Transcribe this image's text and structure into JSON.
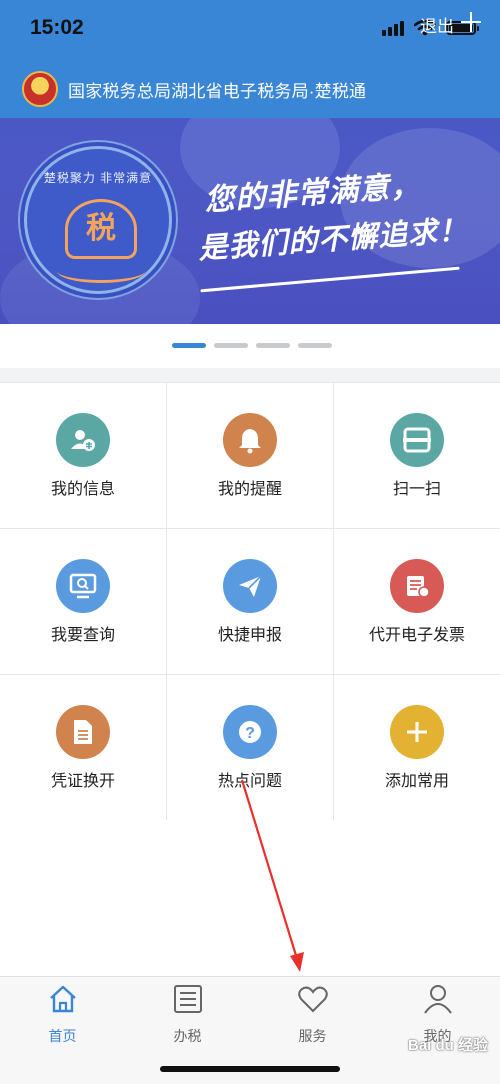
{
  "status_bar": {
    "time": "15:02"
  },
  "header": {
    "title": "国家税务总局湖北省电子税务局·楚税通",
    "logout_label": "退出",
    "accent_color": "#3a86d6"
  },
  "banner": {
    "seal_text": "楚税聚力 非常满意",
    "seal_char": "税",
    "slogan_line1": "您的非常满意，",
    "slogan_line2": "是我们的不懈追求！",
    "slides_total": 4,
    "active_slide": 1
  },
  "grid": {
    "items": [
      {
        "label": "我的信息",
        "icon": "user-info-icon",
        "color": "#5aa7a3"
      },
      {
        "label": "我的提醒",
        "icon": "bell-icon",
        "color": "#d1834e"
      },
      {
        "label": "扫一扫",
        "icon": "scan-icon",
        "color": "#5aa7a3"
      },
      {
        "label": "我要查询",
        "icon": "query-icon",
        "color": "#5a9be0"
      },
      {
        "label": "快捷申报",
        "icon": "send-icon",
        "color": "#5a9be0"
      },
      {
        "label": "代开电子发票",
        "icon": "invoice-icon",
        "color": "#d75a56"
      },
      {
        "label": "凭证换开",
        "icon": "document-icon",
        "color": "#d1834e"
      },
      {
        "label": "热点问题",
        "icon": "question-icon",
        "color": "#5a9be0"
      },
      {
        "label": "添加常用",
        "icon": "plus-icon",
        "color": "#e4b233"
      }
    ]
  },
  "bottom_nav": {
    "items": [
      {
        "label": "首页",
        "icon": "home-icon",
        "active": true
      },
      {
        "label": "办税",
        "icon": "list-icon",
        "active": false
      },
      {
        "label": "服务",
        "icon": "heart-icon",
        "active": false
      },
      {
        "label": "我的",
        "icon": "person-icon",
        "active": false
      }
    ]
  },
  "annotation": {
    "color": "#e8302c"
  },
  "watermark": {
    "text": "Bai du 经验"
  }
}
